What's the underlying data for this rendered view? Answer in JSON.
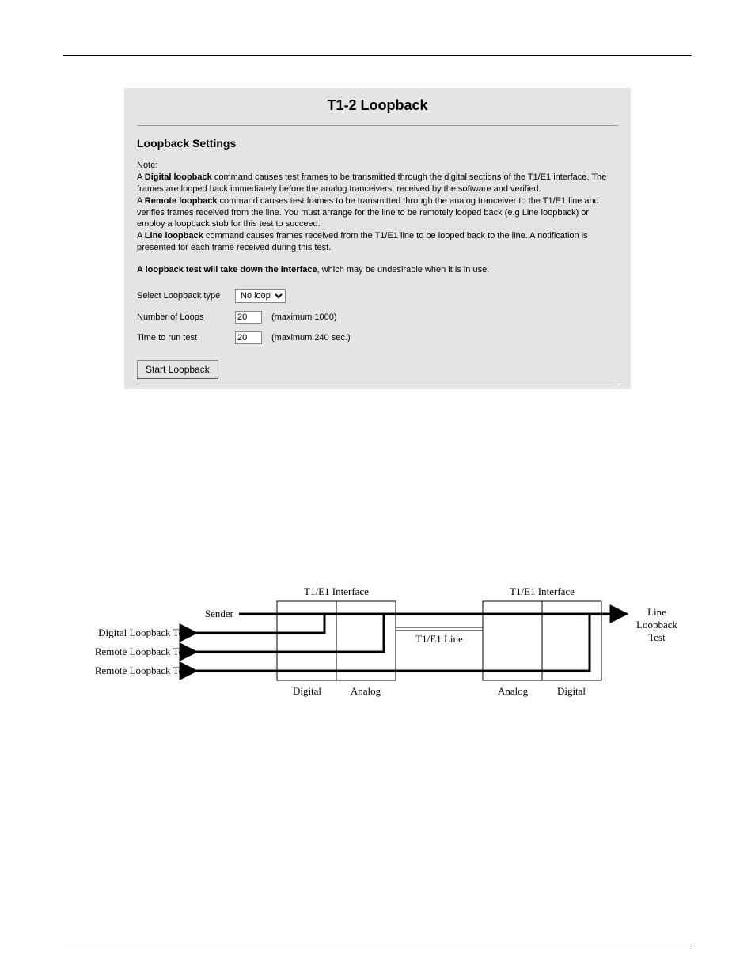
{
  "panel": {
    "title": "T1-2 Loopback",
    "section_heading": "Loopback Settings",
    "note_label": "Note:",
    "note_bold1": "Digital loopback",
    "note_text1": " command causes test frames to be transmitted through the digital sections of the T1/E1 interface. The frames are looped back immediately before the analog tranceivers, received by the software and verified.",
    "note_bold2": "Remote loopback",
    "note_text2": " command causes test frames to be transmitted through the analog tranceiver to the T1/E1 line and verifies frames received from the line. You must arrange for the line to be remotely looped back (e.g Line loopback) or employ a loopback stub for this test to succeed.",
    "note_bold3": "Line loopback",
    "note_text3": " command causes frames received from the T1/E1 line to be looped back to the line. A notification is presented for each frame received during this test.",
    "warn_bold": "A loopback test will take down the interface",
    "warn_text": ", which may be undesirable when it is in use.",
    "form": {
      "row1_label": "Select Loopback type",
      "select_value": "No loop",
      "row2_label": "Number of Loops",
      "loops_value": "20",
      "loops_suffix": "(maximum 1000)",
      "row3_label": "Time to run test",
      "time_value": "20",
      "time_suffix": "(maximum 240 sec.)"
    },
    "button_label": "Start Loopback"
  },
  "diagram": {
    "if_left": "T1/E1 Interface",
    "if_right": "T1/E1 Interface",
    "sender": "Sender",
    "dig_test": "Digital Loopback Test",
    "rem_test1": "Remote Loopback Test",
    "rem_test2": "Remote Loopback Test",
    "line_test": "Line\nLoopback\nTest",
    "t1e1_line": "T1/E1 Line",
    "digital_l": "Digital",
    "analog_l": "Analog",
    "analog_r": "Analog",
    "digital_r": "Digital"
  }
}
